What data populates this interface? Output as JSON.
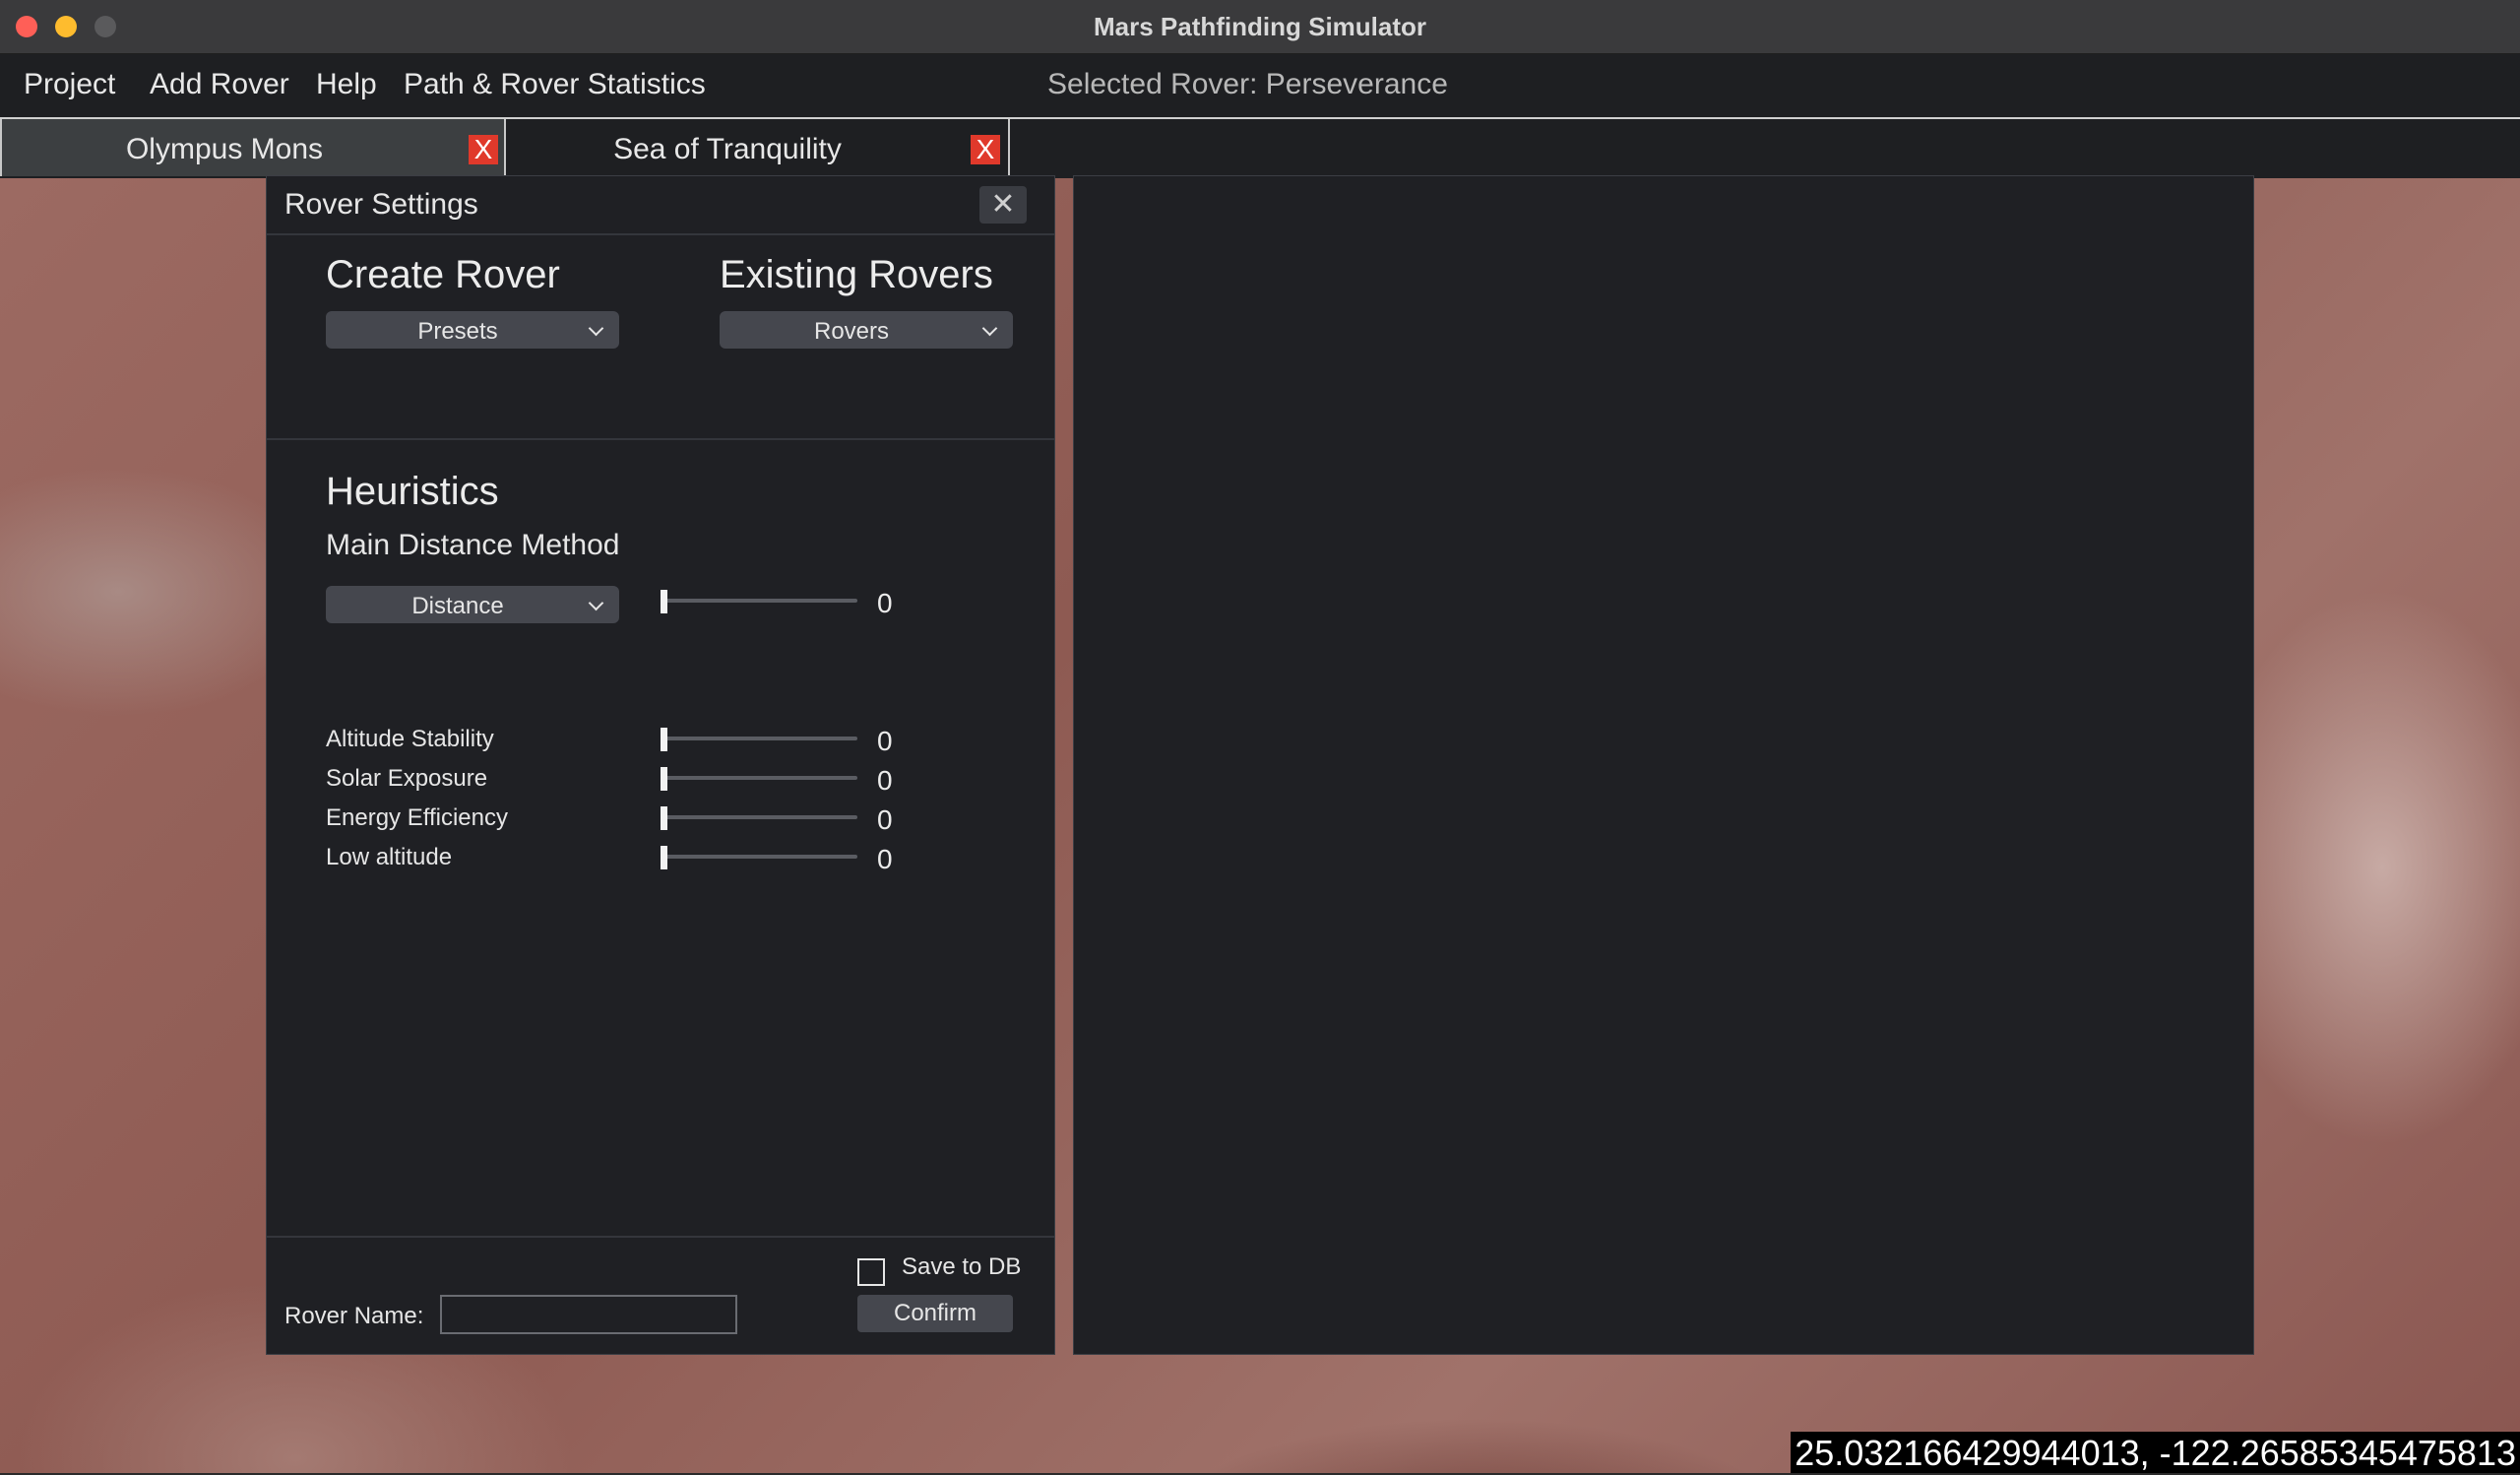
{
  "window": {
    "title": "Mars Pathfinding Simulator"
  },
  "menu": {
    "items": [
      {
        "label": "Project"
      },
      {
        "label": "Add Rover"
      },
      {
        "label": "Help"
      },
      {
        "label": "Path & Rover Statistics"
      }
    ],
    "selected_rover": "Selected Rover: Perseverance"
  },
  "tabs": [
    {
      "label": "Olympus Mons",
      "close": "X",
      "active": true
    },
    {
      "label": "Sea of Tranquility",
      "close": "X",
      "active": false
    }
  ],
  "rover_settings": {
    "title": "Rover Settings",
    "close_glyph": "✕",
    "create_rover": {
      "heading": "Create Rover",
      "dropdown": "Presets"
    },
    "existing_rovers": {
      "heading": "Existing Rovers",
      "dropdown": "Rovers"
    },
    "heuristics": {
      "heading": "Heuristics",
      "main_method_label": "Main Distance Method",
      "main_method_dropdown": "Distance",
      "main_method_value": "0",
      "items": [
        {
          "label": "Altitude Stability",
          "value": "0"
        },
        {
          "label": "Solar Exposure",
          "value": "0"
        },
        {
          "label": "Energy Efficiency",
          "value": "0"
        },
        {
          "label": "Low altitude",
          "value": "0"
        }
      ]
    },
    "save_to_db": {
      "label": "Save to DB",
      "checked": false
    },
    "rover_name": {
      "label": "Rover Name:",
      "value": ""
    },
    "confirm": "Confirm"
  },
  "coordinates": "25.032166429944013, -122.26585345475813",
  "colors": {
    "accent_close": "#e0392b",
    "panel_bg": "#1f2024",
    "menubar_bg": "#1e1f22"
  }
}
